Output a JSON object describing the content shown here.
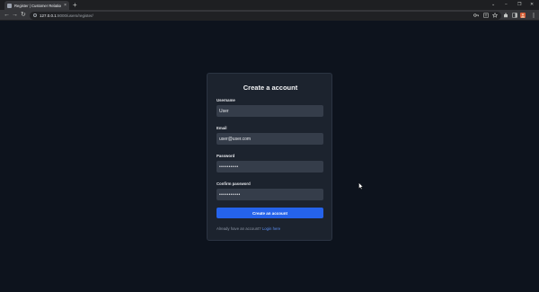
{
  "browser": {
    "tab_title": "Register | Customer Relationship",
    "tab_close": "×",
    "new_tab": "+",
    "url_host": "127.0.0.1",
    "url_rest": ":8000/users/register/",
    "window_controls": {
      "min": "−",
      "max": "❐",
      "close": "✕"
    },
    "nav": {
      "back": "←",
      "forward": "→",
      "reload": "↻"
    },
    "icons": [
      "key-icon",
      "translate-icon",
      "star-icon",
      "extension-icon",
      "sidebar-icon",
      "profile-icon",
      "menu-icon"
    ]
  },
  "form": {
    "title": "Create a account",
    "username": {
      "label": "Username",
      "value": "User"
    },
    "email": {
      "label": "Email",
      "value": "user@user.com"
    },
    "password": {
      "label": "Password",
      "value": "••••••••••"
    },
    "confirm_password": {
      "label": "Confirm password",
      "value": "•••••••••••"
    },
    "submit_label": "Create an account",
    "footer_text": "Already have an account?",
    "login_link": "Login here"
  },
  "colors": {
    "page_bg": "#0d131d",
    "card_bg": "#1c232e",
    "input_bg": "#353d4a",
    "primary": "#2563eb",
    "link": "#5b8def"
  }
}
